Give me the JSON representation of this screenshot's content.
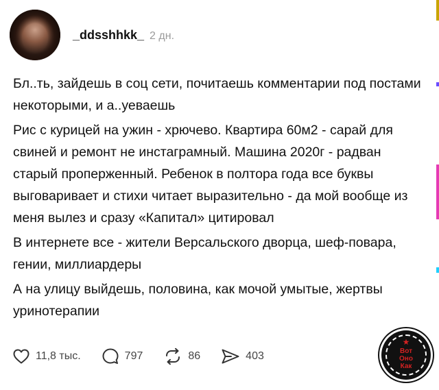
{
  "header": {
    "username": "_ddsshhkk_",
    "time": "2 дн."
  },
  "post": {
    "paragraphs": [
      "Бл..ть, зайдешь в соц сети, почитаешь комментарии под постами некоторыми, и а..уеваешь",
      "Рис с курицей на ужин - хрючево. Квартира 60м2 - сарай для свиней и ремонт не инстаграмный. Машина 2020г - радван старый проперженный. Ребенок в полтора года все буквы выговаривает и стихи читает выразительно - да мой вообще из меня вылез и сразу «Капитал» цитировал",
      "В интернете все - жители Версальского дворца, шеф-повара, гении, миллиардеры",
      "А на улицу выйдешь, половина, как мочой умытые, жертвы уринотерапии"
    ]
  },
  "actions": {
    "likes": "11,8 тыс.",
    "comments": "797",
    "reposts": "86",
    "shares": "403"
  },
  "watermark": {
    "line1": "Вот",
    "line2": "Оно",
    "line3": "Как"
  },
  "colors": {
    "text": "#111111",
    "muted": "#9a9a9a",
    "icon": "#333333",
    "watermark_red": "#d32222"
  },
  "icons": {
    "like": "heart-icon",
    "comment": "comment-icon",
    "repost": "repost-icon",
    "share": "share-icon"
  }
}
